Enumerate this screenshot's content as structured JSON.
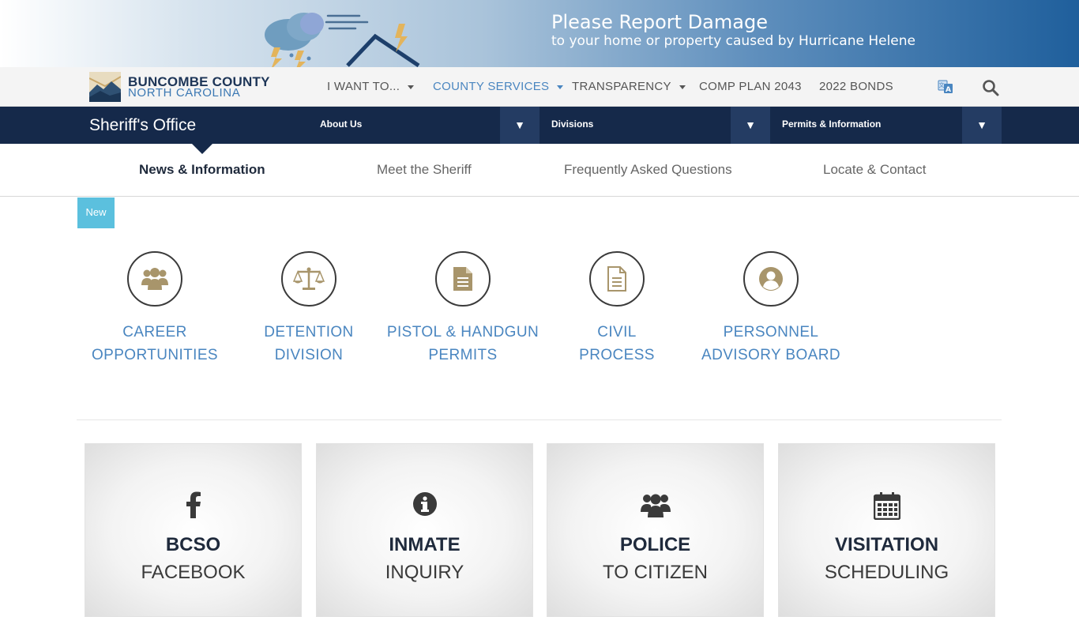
{
  "banner": {
    "title": "Please Report Damage",
    "subtitle": "to your home or property caused by Hurricane Helene"
  },
  "logo": {
    "name": "BUNCOMBE COUNTY",
    "state": "NORTH CAROLINA"
  },
  "topnav": {
    "items": [
      {
        "label": "I WANT TO...",
        "dropdown": true
      },
      {
        "label": "COUNTY SERVICES",
        "dropdown": true,
        "active": true
      },
      {
        "label": "TRANSPARENCY",
        "dropdown": true
      },
      {
        "label": "COMP PLAN 2043",
        "dropdown": false
      },
      {
        "label": "2022 BONDS",
        "dropdown": false
      }
    ],
    "icons": [
      "translate-icon",
      "search-icon"
    ]
  },
  "department": {
    "title": "Sheriff's Office",
    "dropdowns": [
      {
        "label": "About Us",
        "toggle": "▼"
      },
      {
        "label": "Divisions",
        "toggle": "▼"
      },
      {
        "label": "Permits & Information",
        "toggle": "▼"
      }
    ]
  },
  "subtabs": [
    {
      "label": "News & Information",
      "active": true
    },
    {
      "label": "Meet the Sheriff"
    },
    {
      "label": "Frequently Asked Questions"
    },
    {
      "label": "Locate & Contact"
    }
  ],
  "badge": "New",
  "quick_links": [
    {
      "line1": "CAREER",
      "line2": "OPPORTUNITIES",
      "icon": "users-icon"
    },
    {
      "line1": "DETENTION",
      "line2": "DIVISION",
      "icon": "scales-icon"
    },
    {
      "line1": "PISTOL & HANDGUN",
      "line2": "PERMITS",
      "icon": "document-icon"
    },
    {
      "line1": "CIVIL",
      "line2": "PROCESS",
      "icon": "document-outline-icon"
    },
    {
      "line1": "PERSONNEL",
      "line2": "ADVISORY BOARD",
      "icon": "user-circle-icon"
    }
  ],
  "cards": [
    {
      "title": "BCSO",
      "subtitle": "FACEBOOK",
      "icon": "facebook-icon"
    },
    {
      "title": "INMATE",
      "subtitle": "INQUIRY",
      "icon": "info-icon"
    },
    {
      "title": "POLICE",
      "subtitle": "TO CITIZEN",
      "icon": "group-icon"
    },
    {
      "title": "VISITATION",
      "subtitle": "SCHEDULING",
      "icon": "calendar-icon"
    }
  ],
  "colors": {
    "accent": "#4a86c0",
    "navy": "#15294a",
    "icon_gold": "#a8956b",
    "badge": "#5bc0de"
  }
}
